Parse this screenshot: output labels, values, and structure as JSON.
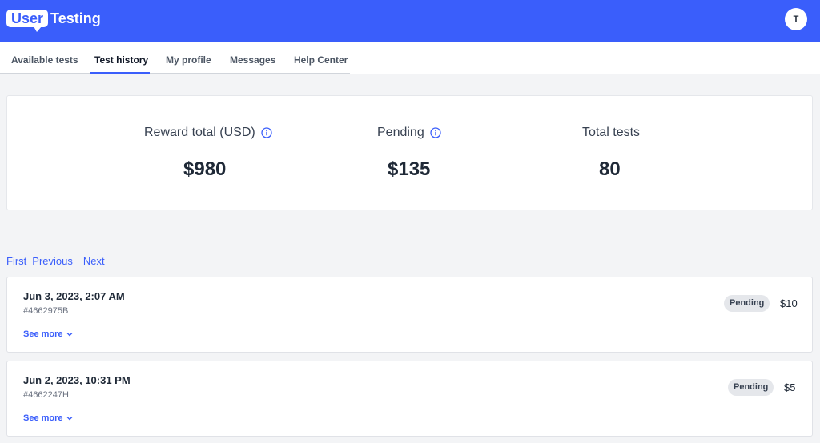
{
  "header": {
    "logo_user": "User",
    "logo_testing": "Testing",
    "avatar_initial": "T"
  },
  "nav": {
    "tabs": [
      {
        "label": "Available tests"
      },
      {
        "label": "Test history"
      },
      {
        "label": "My profile"
      },
      {
        "label": "Messages"
      },
      {
        "label": "Help Center"
      }
    ],
    "active_tab": "Test history"
  },
  "stats": {
    "reward_total": {
      "label": "Reward total (USD)",
      "value": "$980"
    },
    "pending": {
      "label": "Pending",
      "value": "$135"
    },
    "total_tests": {
      "label": "Total tests",
      "value": "80"
    }
  },
  "pagination": {
    "first": "First",
    "previous": "Previous",
    "next": "Next"
  },
  "tests": [
    {
      "date": "Jun 3, 2023, 2:07 AM",
      "id": "#4662975B",
      "status": "Pending",
      "amount": "$10",
      "see_more": "See more"
    },
    {
      "date": "Jun 2, 2023, 10:31 PM",
      "id": "#4662247H",
      "status": "Pending",
      "amount": "$5",
      "see_more": "See more"
    }
  ],
  "colors": {
    "brand": "#3a5efb",
    "background": "#f3f4f6",
    "badge": "#e5e7eb"
  }
}
